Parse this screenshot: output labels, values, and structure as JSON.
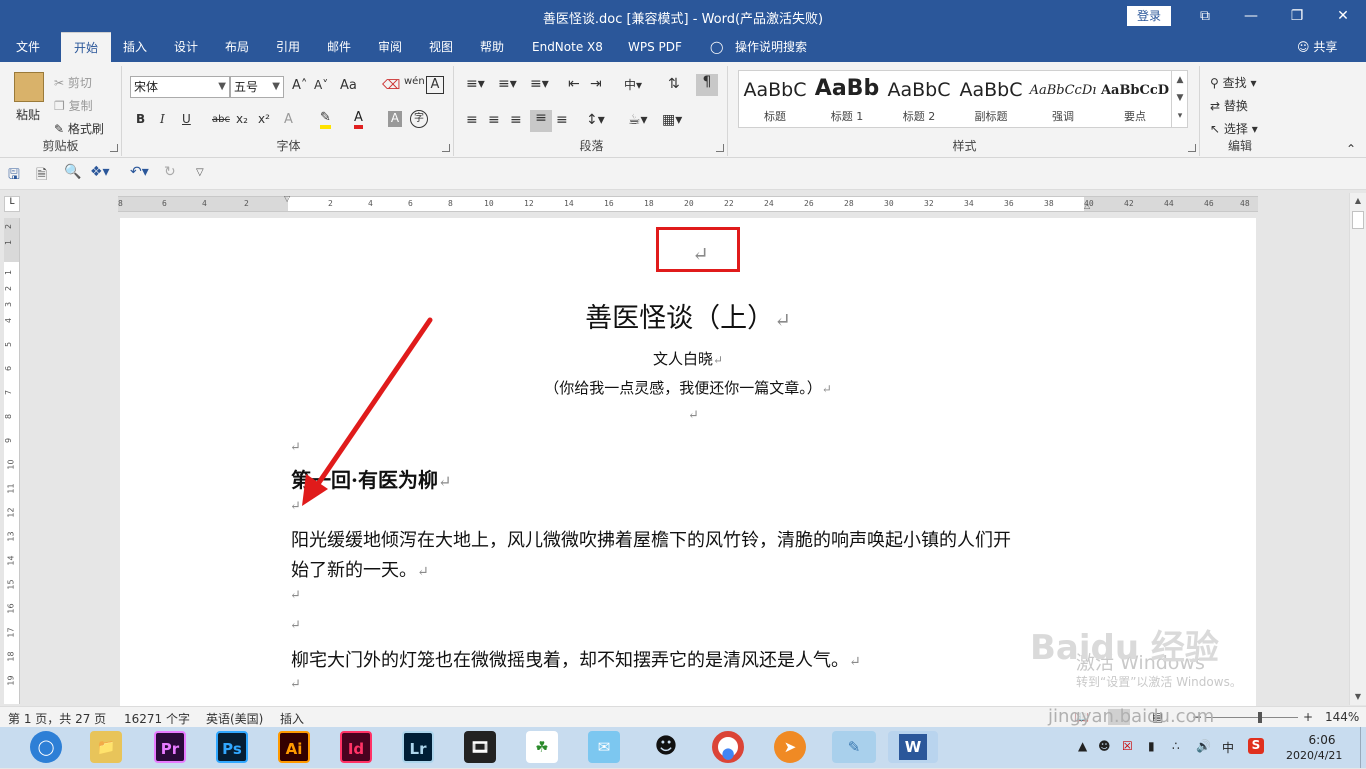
{
  "window": {
    "title": "善医怪谈.doc [兼容模式]  -  Word(产品激活失败)",
    "login_label": "登录",
    "controls": [
      "⧉",
      "—",
      "❐",
      "✕"
    ]
  },
  "tabs": [
    "文件",
    "开始",
    "插入",
    "设计",
    "布局",
    "引用",
    "邮件",
    "审阅",
    "视图",
    "帮助",
    "EndNote X8",
    "WPS PDF",
    "操作说明搜索"
  ],
  "active_tab": "开始",
  "share_label": "共享",
  "ribbon": {
    "clipboard": {
      "paste": "粘贴",
      "cut": "剪切",
      "copy": "复制",
      "painter": "格式刷",
      "label": "剪贴板"
    },
    "font": {
      "name": "宋体",
      "size": "五号",
      "label": "字体",
      "aa": "Aa",
      "bold": "B",
      "italic": "I",
      "underline": "U",
      "strike": "abc",
      "sub": "x₂",
      "sup": "x²",
      "grow": "A˄",
      "shrink": "A˅",
      "wen": "wén",
      "boxA": "A",
      "color_a": "A",
      "shade_a": "A",
      "circle": "字"
    },
    "paragraph": {
      "label": "段落"
    },
    "styles": {
      "label": "样式",
      "items": [
        {
          "preview": "AaBbC",
          "name": "标题"
        },
        {
          "preview": "AaBb",
          "name": "标题 1"
        },
        {
          "preview": "AaBbC",
          "name": "标题 2"
        },
        {
          "preview": "AaBbC",
          "name": "副标题"
        },
        {
          "preview": "AaBbCcDı",
          "name": "强调"
        },
        {
          "preview": "AaBbCcD",
          "name": "要点"
        }
      ]
    },
    "editing": {
      "find": "查找",
      "replace": "替换",
      "select": "选择",
      "label": "编辑"
    }
  },
  "ruler": {
    "h_labels": [
      "8",
      "6",
      "4",
      "2",
      "2",
      "4",
      "6",
      "8",
      "10",
      "12",
      "14",
      "16",
      "18",
      "20",
      "22",
      "24",
      "26",
      "28",
      "30",
      "32",
      "34",
      "36",
      "38",
      "40",
      "42",
      "44",
      "46",
      "48"
    ],
    "v_labels": [
      "2",
      "1",
      "1",
      "2",
      "3",
      "4",
      "5",
      "6",
      "7",
      "8",
      "9",
      "10",
      "11",
      "12",
      "13",
      "14",
      "15",
      "16",
      "17",
      "18",
      "19"
    ]
  },
  "document": {
    "para_mark": "↵",
    "title": "善医怪谈（上）",
    "author": "文人白晓",
    "subtitle": "（你给我一点灵感，我便还你一篇文章。）",
    "chapter": "第一回·有医为柳",
    "p1_line1": "阳光缓缓地倾泻在大地上，风儿微微吹拂着屋檐下的风竹铃，清脆的响声唤起小镇的人们开",
    "p1_line2": "始了新的一天。",
    "p2": "柳宅大门外的灯笼也在微微摇曳着，却不知摆弄它的是清风还是人气。"
  },
  "status": {
    "page": "第 1 页，共 27 页",
    "words": "16271 个字",
    "language": "英语(美国)",
    "mode": "插入",
    "zoom": "144%",
    "minus": "−",
    "plus": "+"
  },
  "watermark": {
    "activate": "激活 Windows",
    "goto": "转到“设置”以激活 Windows。",
    "baidu": "Baidu 经验",
    "url": "jingyan.baidu.com"
  },
  "taskbar": {
    "apps": [
      "Pr",
      "Ps",
      "Ai",
      "Id",
      "Lr"
    ],
    "tray_ime": "中",
    "tray_s": "S",
    "time": "6:06",
    "date": "2020/4/21"
  },
  "colors": {
    "word_blue": "#2b579a",
    "annotation_red": "#e01b1b"
  }
}
